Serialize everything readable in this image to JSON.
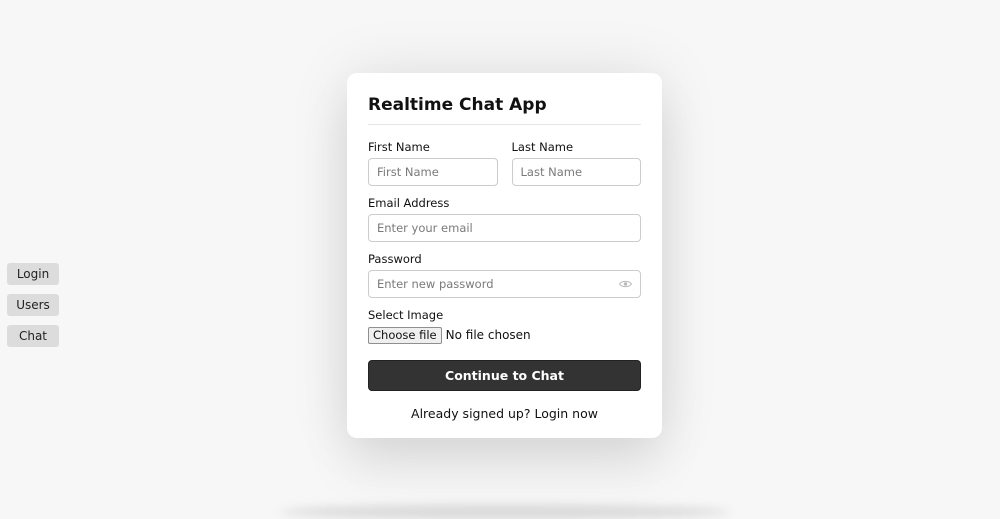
{
  "nav": {
    "items": [
      {
        "label": "Login"
      },
      {
        "label": "Users"
      },
      {
        "label": "Chat"
      }
    ]
  },
  "form": {
    "title": "Realtime Chat App",
    "first_name": {
      "label": "First Name",
      "placeholder": "First Name"
    },
    "last_name": {
      "label": "Last Name",
      "placeholder": "Last Name"
    },
    "email": {
      "label": "Email Address",
      "placeholder": "Enter your email"
    },
    "password": {
      "label": "Password",
      "placeholder": "Enter new password",
      "icon": "eye-icon"
    },
    "image": {
      "label": "Select Image",
      "button_label": "Choose file",
      "status": "No file chosen"
    },
    "submit_label": "Continue to Chat",
    "footer_text": "Already signed up?",
    "footer_link": "Login now"
  },
  "colors": {
    "background": "#f7f7f7",
    "card": "#ffffff",
    "button": "#333333",
    "nav_button": "#dcdcdc"
  }
}
